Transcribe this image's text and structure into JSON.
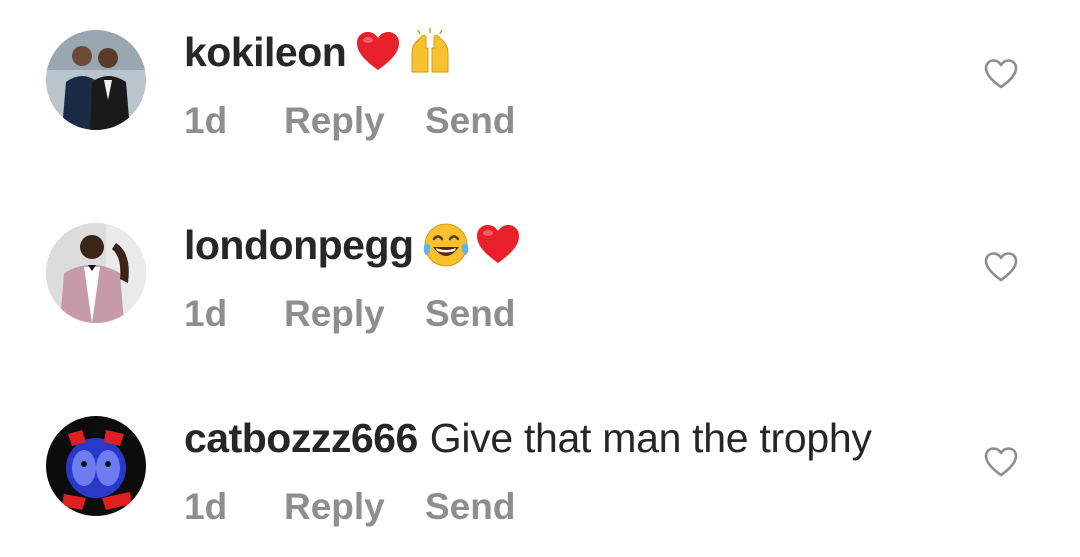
{
  "comments": [
    {
      "username": "kokileon",
      "text": "",
      "emojis": [
        "heart-emoji",
        "raising-hands-emoji"
      ],
      "time": "1d",
      "reply_label": "Reply",
      "send_label": "Send"
    },
    {
      "username": "londonpegg",
      "text": "",
      "emojis": [
        "tears-of-joy-emoji",
        "heart-emoji"
      ],
      "time": "1d",
      "reply_label": "Reply",
      "send_label": "Send"
    },
    {
      "username": "catbozzz666",
      "text": "Give that man the trophy",
      "emojis": [],
      "time": "1d",
      "reply_label": "Reply",
      "send_label": "Send"
    }
  ],
  "colors": {
    "text": "#262626",
    "meta": "#8e8e8e",
    "heart_outline": "#8e8e8e",
    "heart_emoji": "#e8202a",
    "emoji_yellow": "#f9c12e"
  },
  "icons": {
    "like": "heart-outline-icon"
  }
}
